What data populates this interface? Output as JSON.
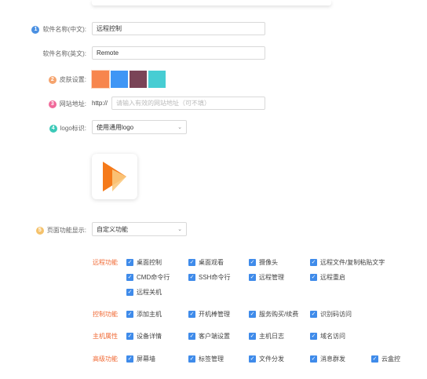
{
  "form": {
    "name_cn": {
      "num": "1",
      "label": "软件名称(中文):",
      "value": "远程控制",
      "color": "#4a90e2"
    },
    "name_en": {
      "label": "软件名称(英文):",
      "value": "Remote"
    },
    "skin": {
      "num": "2",
      "label": "皮肤设置:",
      "color": "#f5a36d",
      "swatches": [
        "#f7864e",
        "#3f96f5",
        "#7a4457",
        "#47cdd3"
      ]
    },
    "website": {
      "num": "3",
      "label": "网站地址:",
      "prefix": "http://",
      "placeholder": "请输入有效的网站地址（可不填）",
      "color": "#f06a9a"
    },
    "logo": {
      "num": "4",
      "label": "logo标识:",
      "value": "使用通用logo",
      "color": "#3cc9b8"
    },
    "page_func": {
      "num": "5",
      "label": "页面功能显示:",
      "value": "自定义功能",
      "color": "#f5c26b"
    }
  },
  "groups": [
    {
      "label": "远程功能",
      "rows": [
        [
          "桌面控制",
          "桌面观看",
          "摄像头",
          "远程文件/复制粘贴文字"
        ],
        [
          "CMD命令行",
          "SSH命令行",
          "远程管理",
          "远程重启"
        ],
        [
          "远程关机"
        ]
      ]
    },
    {
      "label": "控制功能",
      "rows": [
        [
          "添加主机",
          "开机棒管理",
          "服务购买/续费",
          "识别码访问"
        ]
      ]
    },
    {
      "label": "主机属性",
      "rows": [
        [
          "设备详情",
          "客户端设置",
          "主机日志",
          "域名访问"
        ]
      ]
    },
    {
      "label": "高级功能",
      "rows": [
        [
          "屏幕墙",
          "标签管理",
          "文件分发",
          "消息群发",
          "云盒控"
        ]
      ]
    }
  ]
}
